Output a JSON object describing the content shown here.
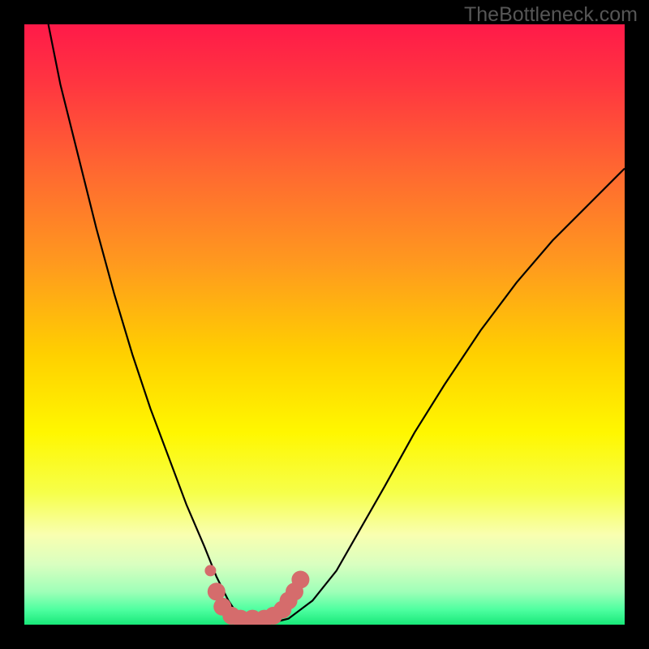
{
  "watermark": "TheBottleneck.com",
  "chart_data": {
    "type": "line",
    "title": "",
    "xlabel": "",
    "ylabel": "",
    "xlim": [
      0,
      100
    ],
    "ylim": [
      0,
      100
    ],
    "gradient_stops": [
      {
        "pos": 0.0,
        "color": "#ff1a49"
      },
      {
        "pos": 0.1,
        "color": "#ff3640"
      },
      {
        "pos": 0.25,
        "color": "#ff6a30"
      },
      {
        "pos": 0.4,
        "color": "#ff9a1e"
      },
      {
        "pos": 0.55,
        "color": "#ffd000"
      },
      {
        "pos": 0.68,
        "color": "#fff700"
      },
      {
        "pos": 0.78,
        "color": "#f6ff4a"
      },
      {
        "pos": 0.85,
        "color": "#f9ffb0"
      },
      {
        "pos": 0.9,
        "color": "#d9ffc0"
      },
      {
        "pos": 0.945,
        "color": "#9fffb8"
      },
      {
        "pos": 0.975,
        "color": "#4effa0"
      },
      {
        "pos": 1.0,
        "color": "#18e879"
      }
    ],
    "series": [
      {
        "name": "bottleneck-curve",
        "x": [
          4,
          6,
          9,
          12,
          15,
          18,
          21,
          24,
          27,
          30,
          32,
          34,
          36,
          38,
          40,
          44,
          48,
          52,
          56,
          60,
          65,
          70,
          76,
          82,
          88,
          94,
          100
        ],
        "y_pct": [
          100,
          90,
          78,
          66,
          55,
          45,
          36,
          28,
          20,
          13,
          8,
          4,
          1,
          0,
          0,
          1,
          4,
          9,
          16,
          23,
          32,
          40,
          49,
          57,
          64,
          70,
          76
        ],
        "min_flat_x_range": [
          34,
          42
        ],
        "min_flat_y_pct": 0
      },
      {
        "name": "highlight-dots",
        "points": [
          {
            "x": 31.0,
            "y_pct": 9.0
          },
          {
            "x": 32.0,
            "y_pct": 5.5
          },
          {
            "x": 33.0,
            "y_pct": 3.0
          },
          {
            "x": 34.5,
            "y_pct": 1.5
          },
          {
            "x": 36.0,
            "y_pct": 1.0
          },
          {
            "x": 38.0,
            "y_pct": 1.0
          },
          {
            "x": 40.0,
            "y_pct": 1.0
          },
          {
            "x": 41.5,
            "y_pct": 1.5
          },
          {
            "x": 43.0,
            "y_pct": 2.5
          },
          {
            "x": 44.0,
            "y_pct": 4.0
          },
          {
            "x": 45.0,
            "y_pct": 5.5
          },
          {
            "x": 46.0,
            "y_pct": 7.5
          }
        ],
        "color": "#d56c6c"
      }
    ]
  }
}
